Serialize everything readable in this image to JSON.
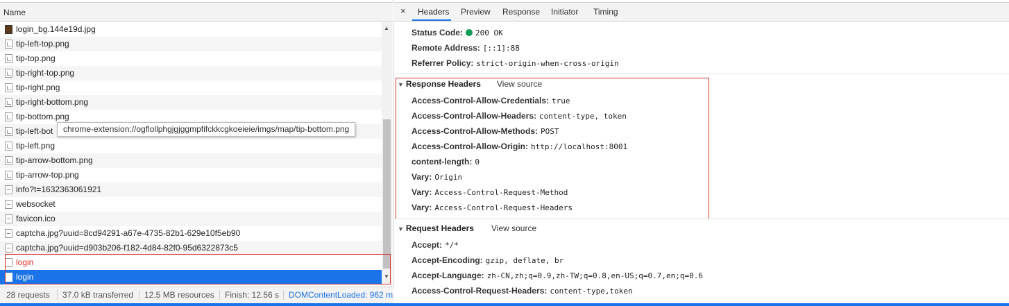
{
  "left": {
    "header": "Name",
    "files": [
      {
        "name": "login_bg.144e19d.jpg",
        "icon": "image-dark-icon"
      },
      {
        "name": "tip-left-top.png",
        "icon": "image-icon"
      },
      {
        "name": "tip-top.png",
        "icon": "image-icon"
      },
      {
        "name": "tip-right-top.png",
        "icon": "image-icon"
      },
      {
        "name": "tip-right.png",
        "icon": "image-icon"
      },
      {
        "name": "tip-right-bottom.png",
        "icon": "image-icon"
      },
      {
        "name": "tip-bottom.png",
        "icon": "image-icon"
      },
      {
        "name": "tip-left-bot",
        "icon": "image-icon"
      },
      {
        "name": "tip-left.png",
        "icon": "image-icon"
      },
      {
        "name": "tip-arrow-bottom.png",
        "icon": "image-icon"
      },
      {
        "name": "tip-arrow-top.png",
        "icon": "image-icon"
      },
      {
        "name": "info?t=1632363061921",
        "icon": "document-icon"
      },
      {
        "name": "websocket",
        "icon": "document-icon"
      },
      {
        "name": "favicon.ico",
        "icon": "document-icon"
      },
      {
        "name": "captcha.jpg?uuid=8cd94291-a67e-4735-82b1-629e10f5eb90",
        "icon": "document-icon"
      },
      {
        "name": "captcha.jpg?uuid=d903b206-f182-4d84-82f0-95d6322873c5",
        "icon": "document-icon"
      },
      {
        "name": "login",
        "icon": "document-icon",
        "state": "failed"
      },
      {
        "name": "login",
        "icon": "document-icon",
        "state": "selected"
      }
    ],
    "tooltip": "chrome-extension://ogflollphgjgjggmpfifckkcgkoeieie/imgs/map/tip-bottom.png",
    "status": {
      "requests": "28 requests",
      "transferred": "37.0 kB transferred",
      "resources": "12.5 MB resources",
      "finish": "Finish: 12.56 s",
      "dom": "DOMContentLoaded: 962 m"
    }
  },
  "right": {
    "close": "×",
    "tabs": [
      "Headers",
      "Preview",
      "Response",
      "Initiator",
      "Timing"
    ],
    "general": [
      {
        "key": "Status Code:",
        "value": "200 OK"
      },
      {
        "key": "Remote Address:",
        "value": "[::1]:88"
      },
      {
        "key": "Referrer Policy:",
        "value": "strict-origin-when-cross-origin"
      }
    ],
    "response_headers": {
      "title": "Response Headers",
      "view_source": "View source",
      "items": [
        {
          "key": "Access-Control-Allow-Credentials:",
          "value": "true"
        },
        {
          "key": "Access-Control-Allow-Headers:",
          "value": "content-type, token"
        },
        {
          "key": "Access-Control-Allow-Methods:",
          "value": "POST"
        },
        {
          "key": "Access-Control-Allow-Origin:",
          "value": "http://localhost:8001"
        },
        {
          "key": "content-length:",
          "value": "0"
        },
        {
          "key": "Vary:",
          "value": "Origin"
        },
        {
          "key": "Vary:",
          "value": "Access-Control-Request-Method"
        },
        {
          "key": "Vary:",
          "value": "Access-Control-Request-Headers"
        }
      ]
    },
    "request_headers": {
      "title": "Request Headers",
      "view_source": "View source",
      "items": [
        {
          "key": "Accept:",
          "value": "*/*"
        },
        {
          "key": "Accept-Encoding:",
          "value": "gzip, deflate, br"
        },
        {
          "key": "Accept-Language:",
          "value": "zh-CN,zh;q=0.9,zh-TW;q=0.8,en-US;q=0.7,en;q=0.6"
        },
        {
          "key": "Access-Control-Request-Headers:",
          "value": "content-type,token"
        }
      ]
    }
  },
  "colors": {
    "accent": "#1a73e8",
    "error": "#d93025",
    "success": "#0f9d58"
  }
}
